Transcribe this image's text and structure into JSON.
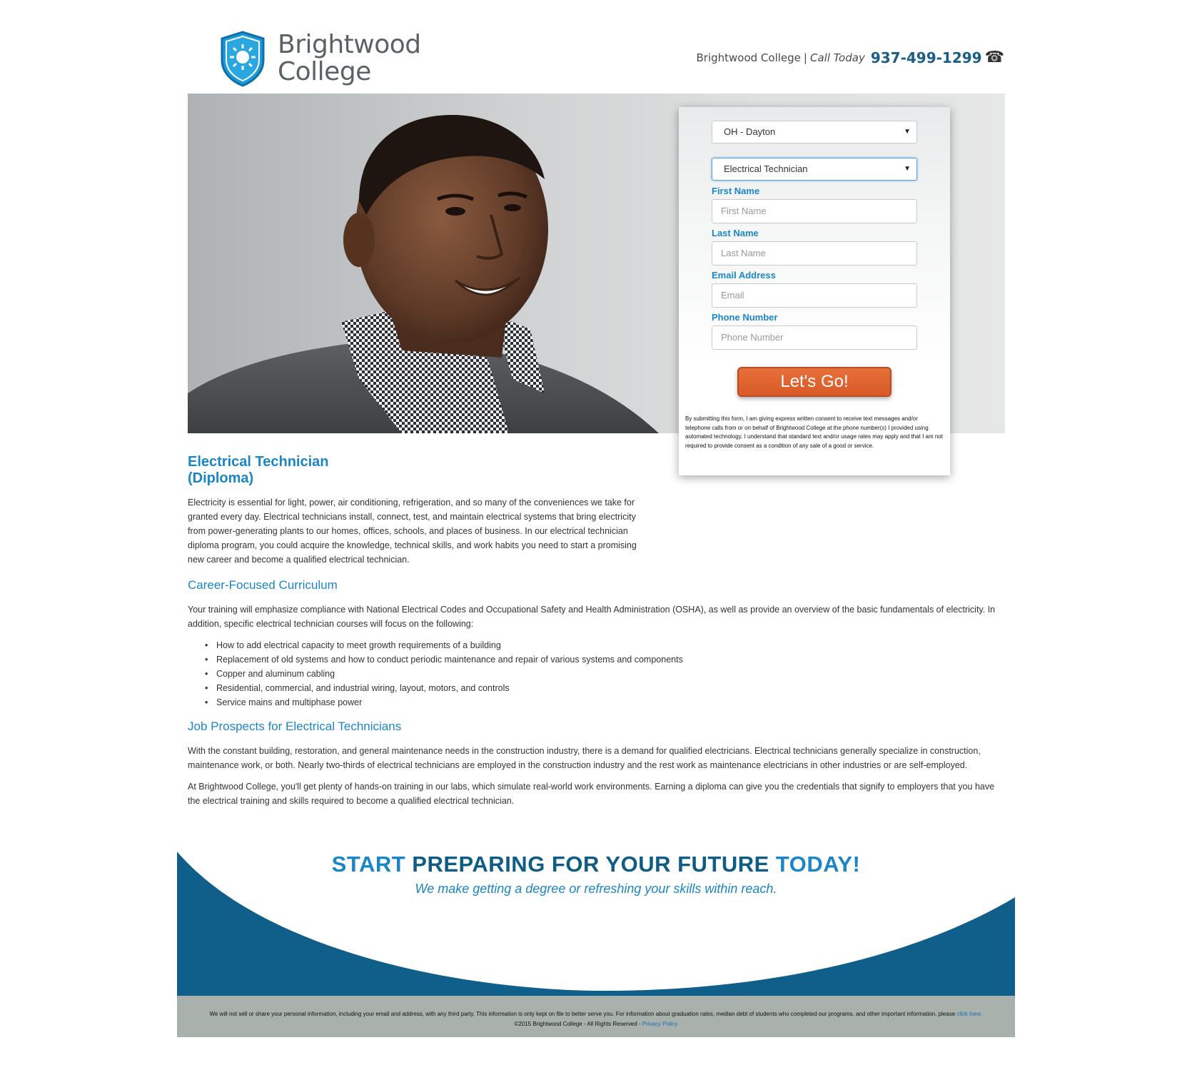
{
  "header": {
    "logo_line1": "Brightwood",
    "logo_line2": "College",
    "contact_name": "Brightwood College",
    "separator": "|",
    "call_label": "Call Today",
    "phone": "937-499-1299",
    "phone_icon": "☎"
  },
  "form": {
    "campus_select": "OH - Dayton",
    "program_select": "Electrical Technician",
    "first_name_label": "First Name",
    "first_name_placeholder": "First Name",
    "last_name_label": "Last Name",
    "last_name_placeholder": "Last Name",
    "email_label": "Email Address",
    "email_placeholder": "Email",
    "phone_label": "Phone Number",
    "phone_placeholder": "Phone Number",
    "submit_label": "Let's Go!",
    "consent": "By submitting this form, I am giving express written consent to receive text messages and/or telephone calls from or on behalf of Brightwood College at the phone number(s) I provided using automated technology. I understand that standard text and/or usage rates may apply and that I am not required to provide consent as a condition of any sale of a good or service."
  },
  "content": {
    "title_line1": "Electrical Technician",
    "title_line2": "(Diploma)",
    "intro": "Electricity is essential for light, power, air conditioning, refrigeration, and so many of the conveniences we take for granted every day. Electrical technicians install, connect, test, and maintain electrical systems that bring electricity from power-generating plants to our homes, offices, schools, and places of business. In our electrical technician diploma program, you could acquire the knowledge, technical skills, and work habits you need to start a promising new career and become a qualified electrical technician.",
    "curriculum_heading": "Career-Focused Curriculum",
    "curriculum_text": "Your training will emphasize compliance with National Electrical Codes and Occupational Safety and Health Administration (OSHA), as well as provide an overview of the basic fundamentals of electricity. In addition, specific electrical technician courses will focus on the following:",
    "bullets": [
      "How to add electrical capacity to meet growth requirements of a building",
      "Replacement of old systems and how to conduct periodic maintenance and repair of various systems and components",
      "Copper and aluminum cabling",
      "Residential, commercial, and industrial wiring, layout, motors, and controls",
      "Service mains and multiphase power"
    ],
    "jobs_heading": "Job Prospects for Electrical Technicians",
    "jobs_text1": "With the constant building, restoration, and general maintenance needs in the construction industry, there is a demand for qualified electricians. Electrical technicians generally specialize in construction, maintenance work, or both. Nearly two-thirds of electrical technicians are employed in the construction industry and the rest work as maintenance electricians in other industries or are self-employed.",
    "jobs_text2": "At Brightwood College, you'll get plenty of hands-on training in our labs, which simulate real-world work environments. Earning a diploma can give you the credentials that signify to employers that you have the electrical training and skills required to become a qualified electrical technician."
  },
  "cta": {
    "word1": "START",
    "middle": "PREPARING FOR YOUR FUTURE",
    "word2": "TODAY!",
    "subtitle": "We make getting a degree or refreshing your skills within reach."
  },
  "footer": {
    "privacy_text": "We will not sell or share your personal information, including your email and address, with any third party. This information is only kept on file to better serve you. For information about graduation rates, median debt of students who completed our programs, and other important information, please",
    "click_here": "click here.",
    "copyright": "©2015 Brightwood College - All Rights Reserved -",
    "privacy_policy": "Privacy Policy"
  },
  "colors": {
    "brand_blue": "#1b86c6",
    "dark_blue": "#0f5c85",
    "button_orange": "#d85a27",
    "footer_gray": "#a9b1ad"
  }
}
